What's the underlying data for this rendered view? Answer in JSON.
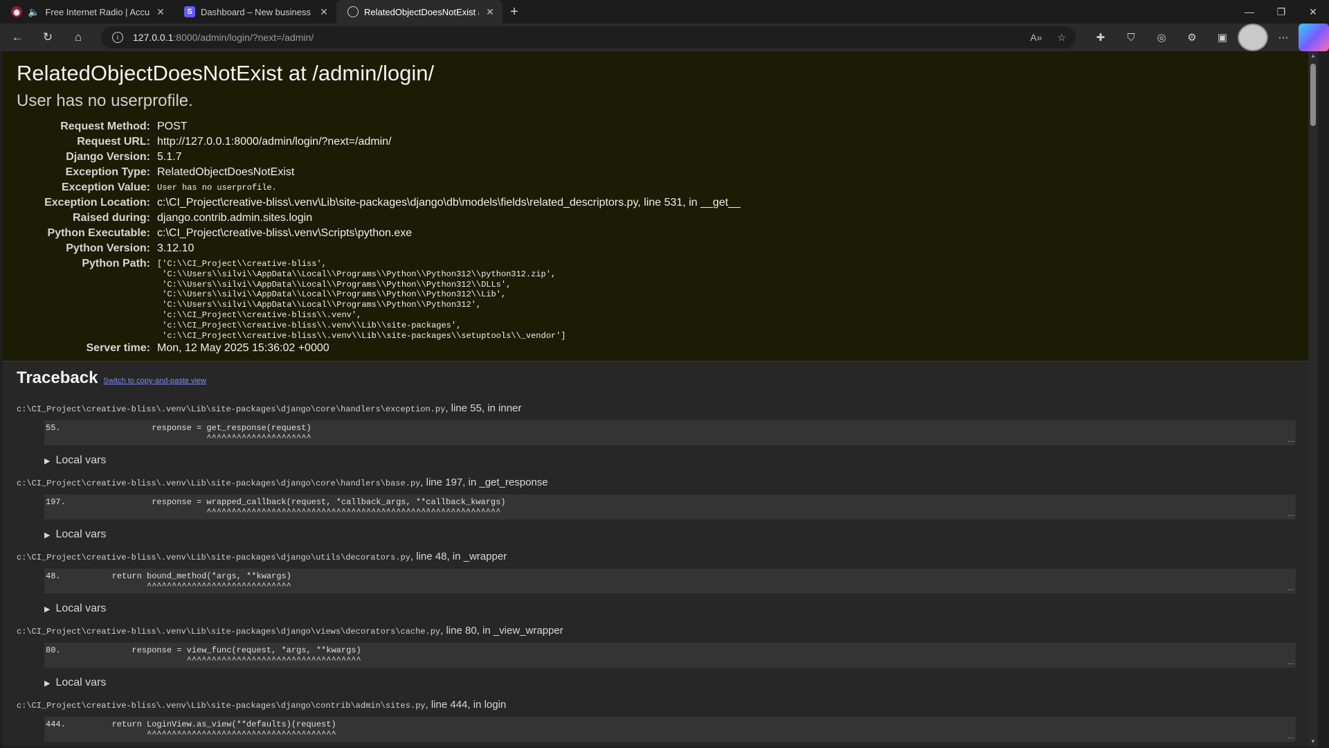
{
  "tabs": [
    {
      "title": "Free Internet Radio | AccuRadio",
      "favicon": "radio-icon"
    },
    {
      "title": "Dashboard – New business sandbox",
      "favicon": "stripe-icon"
    },
    {
      "title": "RelatedObjectDoesNotExist at /admin/login/",
      "favicon": "globe-icon"
    }
  ],
  "toolbar": {
    "url_host": "127.0.0.1",
    "url_rest": ":8000/admin/login/?next=/admin/"
  },
  "error": {
    "title": "RelatedObjectDoesNotExist at /admin/login/",
    "subtitle": "User has no userprofile."
  },
  "meta": [
    {
      "label": "Request Method:",
      "value": "POST",
      "mono": false
    },
    {
      "label": "Request URL:",
      "value": "http://127.0.0.1:8000/admin/login/?next=/admin/",
      "mono": false
    },
    {
      "label": "Django Version:",
      "value": "5.1.7",
      "mono": false
    },
    {
      "label": "Exception Type:",
      "value": "RelatedObjectDoesNotExist",
      "mono": false
    },
    {
      "label": "Exception Value:",
      "value": "User has no userprofile.",
      "mono": true
    },
    {
      "label": "Exception Location:",
      "value": "c:\\CI_Project\\creative-bliss\\.venv\\Lib\\site-packages\\django\\db\\models\\fields\\related_descriptors.py, line 531, in __get__",
      "mono": false
    },
    {
      "label": "Raised during:",
      "value": "django.contrib.admin.sites.login",
      "mono": false
    },
    {
      "label": "Python Executable:",
      "value": "c:\\CI_Project\\creative-bliss\\.venv\\Scripts\\python.exe",
      "mono": false
    },
    {
      "label": "Python Version:",
      "value": "3.12.10",
      "mono": false
    }
  ],
  "python_path": {
    "label": "Python Path:",
    "value": "['C:\\\\CI_Project\\\\creative-bliss',\n 'C:\\\\Users\\\\silvi\\\\AppData\\\\Local\\\\Programs\\\\Python\\\\Python312\\\\python312.zip',\n 'C:\\\\Users\\\\silvi\\\\AppData\\\\Local\\\\Programs\\\\Python\\\\Python312\\\\DLLs',\n 'C:\\\\Users\\\\silvi\\\\AppData\\\\Local\\\\Programs\\\\Python\\\\Python312\\\\Lib',\n 'C:\\\\Users\\\\silvi\\\\AppData\\\\Local\\\\Programs\\\\Python\\\\Python312',\n 'c:\\\\CI_Project\\\\creative-bliss\\\\.venv',\n 'c:\\\\CI_Project\\\\creative-bliss\\\\.venv\\\\Lib\\\\site-packages',\n 'c:\\\\CI_Project\\\\creative-bliss\\\\.venv\\\\Lib\\\\site-packages\\\\setuptools\\\\_vendor']"
  },
  "server_time": {
    "label": "Server time:",
    "value": "Mon, 12 May 2025 15:36:02 +0000"
  },
  "traceback": {
    "heading": "Traceback",
    "switch_link": "Switch to copy-and-paste view",
    "local_vars_label": "Local vars",
    "frames": [
      {
        "file": "c:\\CI_Project\\creative-bliss\\.venv\\Lib\\site-packages\\django\\core\\handlers\\exception.py",
        "where": "line 55, in inner",
        "lineno": "55.",
        "code": "                response = get_response(request)",
        "carets": "                           ^^^^^^^^^^^^^^^^^^^^^"
      },
      {
        "file": "c:\\CI_Project\\creative-bliss\\.venv\\Lib\\site-packages\\django\\core\\handlers\\base.py",
        "where": "line 197, in _get_response",
        "lineno": "197.",
        "code": "                response = wrapped_callback(request, *callback_args, **callback_kwargs)",
        "carets": "                           ^^^^^^^^^^^^^^^^^^^^^^^^^^^^^^^^^^^^^^^^^^^^^^^^^^^^^^^^^^^"
      },
      {
        "file": "c:\\CI_Project\\creative-bliss\\.venv\\Lib\\site-packages\\django\\utils\\decorators.py",
        "where": "line 48, in _wrapper",
        "lineno": "48.",
        "code": "        return bound_method(*args, **kwargs)",
        "carets": "               ^^^^^^^^^^^^^^^^^^^^^^^^^^^^^"
      },
      {
        "file": "c:\\CI_Project\\creative-bliss\\.venv\\Lib\\site-packages\\django\\views\\decorators\\cache.py",
        "where": "line 80, in _view_wrapper",
        "lineno": "80.",
        "code": "            response = view_func(request, *args, **kwargs)",
        "carets": "                       ^^^^^^^^^^^^^^^^^^^^^^^^^^^^^^^^^^^"
      },
      {
        "file": "c:\\CI_Project\\creative-bliss\\.venv\\Lib\\site-packages\\django\\contrib\\admin\\sites.py",
        "where": "line 444, in login",
        "lineno": "444.",
        "code": "        return LoginView.as_view(**defaults)(request)",
        "carets": "               ^^^^^^^^^^^^^^^^^^^^^^^^^^^^^^^^^^^^^^"
      }
    ]
  }
}
